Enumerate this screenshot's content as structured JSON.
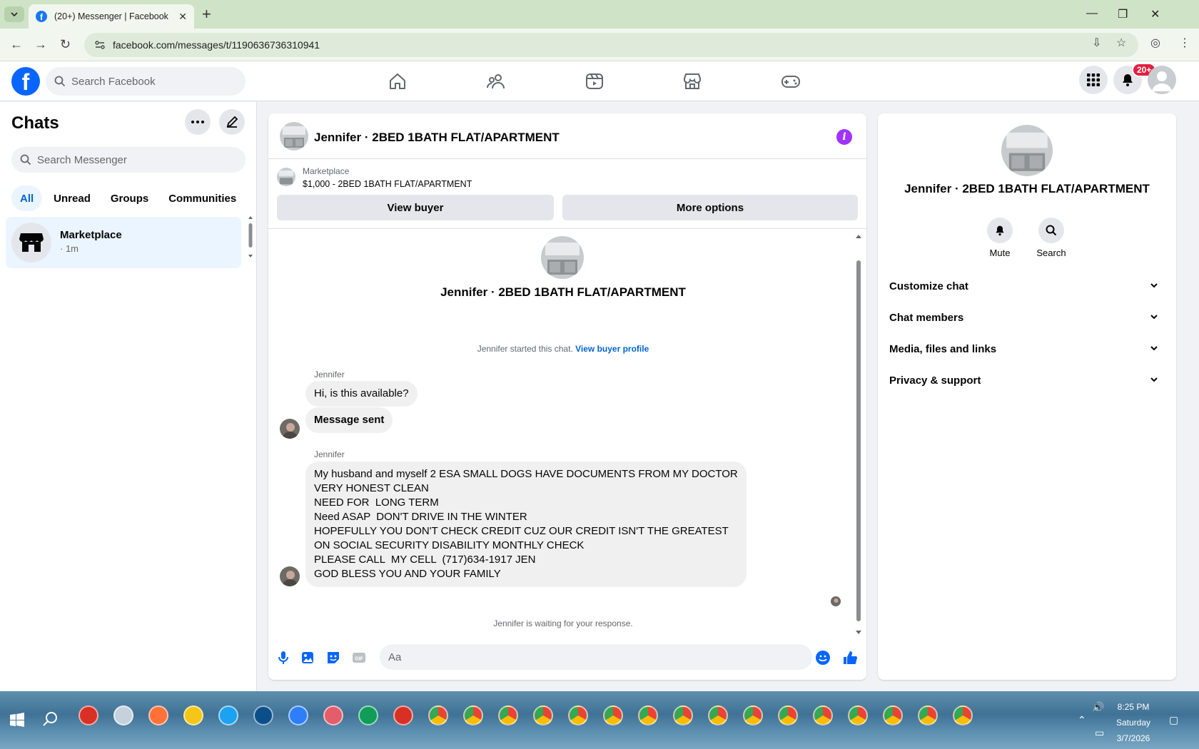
{
  "browser": {
    "tab_title": "(20+) Messenger | Facebook",
    "url": "facebook.com/messages/t/1190636736310941"
  },
  "fb": {
    "search_placeholder": "Search Facebook",
    "notification_badge": "20+"
  },
  "left": {
    "title": "Chats",
    "search_placeholder": "Search Messenger",
    "filters": [
      "All",
      "Unread",
      "Groups",
      "Communities"
    ],
    "active_filter": "All",
    "chats": [
      {
        "name": "Marketplace",
        "meta": "· 1m"
      }
    ]
  },
  "conversation": {
    "title": "Jennifer · 2BED 1BATH FLAT/APARTMENT",
    "listing_label": "Marketplace",
    "listing_price": "$1,000 - 2BED 1BATH FLAT/APARTMENT",
    "view_buyer": "View buyer",
    "more_options": "More options",
    "thread_name": "Jennifer · 2BED 1BATH FLAT/APARTMENT",
    "started_text": "Jennifer started this chat.",
    "started_link": "View buyer profile",
    "messages": [
      {
        "sender": "Jennifer",
        "text": "Hi, is this available?"
      },
      {
        "text": "Message sent"
      },
      {
        "sender": "Jennifer",
        "lines": [
          "My husband and myself 2 ESA SMALL DOGS HAVE DOCUMENTS FROM MY DOCTOR",
          "VERY HONEST CLEAN",
          "NEED FOR  LONG TERM",
          "Need ASAP  DON'T DRIVE IN THE WINTER",
          "HOPEFULLY YOU DON'T CHECK CREDIT CUZ OUR CREDIT ISN'T THE GREATEST",
          "ON SOCIAL SECURITY DISABILITY MONTHLY CHECK",
          "PLEASE CALL  MY CELL  (717)634-1917 JEN",
          "GOD BLESS YOU AND YOUR FAMILY"
        ]
      }
    ],
    "waiting_text": "Jennifer is waiting for your response.",
    "composer_placeholder": "Aa"
  },
  "details": {
    "name": "Jennifer · 2BED 1BATH FLAT/APARTMENT",
    "actions": [
      "Mute",
      "Search"
    ],
    "sections": [
      "Customize chat",
      "Chat members",
      "Media, files and links",
      "Privacy & support"
    ]
  },
  "taskbar": {
    "time": "8:25 PM",
    "day": "Saturday",
    "date": "3/7/2026"
  },
  "colors": {
    "fb_blue": "#0866ff",
    "link": "#0064d1",
    "info_purple": "#a033ff",
    "badge_red": "#e41e3f"
  },
  "icons": [
    "home-icon",
    "friends-icon",
    "video-icon",
    "marketplace-icon",
    "gaming-icon",
    "menu-grid-icon",
    "bell-icon",
    "microphone-icon",
    "image-icon",
    "sticker-icon",
    "gif-icon",
    "emoji-icon",
    "thumbs-up-icon"
  ]
}
